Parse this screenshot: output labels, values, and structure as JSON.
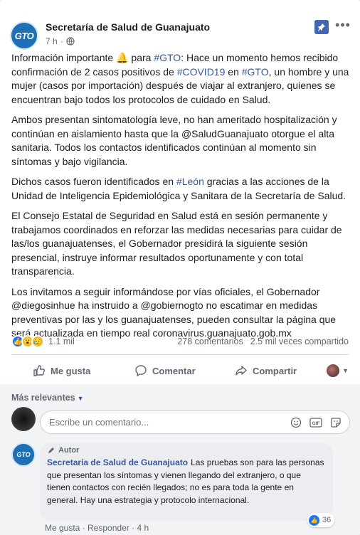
{
  "post": {
    "page_name": "Secretaría de Salud de Guanajuato",
    "avatar_text": "GTO",
    "time": "7 h",
    "paragraphs": {
      "p1": {
        "a": "Información importante ",
        "emoji": "🔔",
        "b": " para ",
        "tag1": "#GTO",
        "c": ": Hace un momento hemos recibido confirmación de 2 casos positivos de ",
        "tag2": "#COVID19",
        "d": " en ",
        "tag3": "#GTO",
        "e": ", un hombre y una mujer (casos por importación) después de viajar al extranjero, quienes se encuentran bajo todos los protocolos de cuidado en Salud."
      },
      "p2": "Ambos presentan sintomatología leve, no han ameritado hospitalización y continúan en aislamiento hasta que la @SaludGuanajuato otorgue el alta sanitaria. Todos los contactos identificados continúan al momento sin síntomas y bajo vigilancia.",
      "p3": {
        "a": "Dichos casos fueron identificados en ",
        "tag": "#León",
        "b": " gracias a las acciones de la Unidad de Inteligencia Epidemiológica y Sanitara de la Secretaría de Salud."
      },
      "p4": "El Consejo Estatal de Seguridad en Salud está en sesión permanente y trabajamos coordinados en reforzar las medidas necesarias para cuidar de las/los guanajuatenses, el Gobernador presidirá la siguiente sesión presencial, instruye informar resultados oportunamente y con total transparencia.",
      "p5": "Los invitamos a seguir informándose por vías oficiales, el Gobernador @diegosinhue ha instruido a @gobiernogto no escatimar en medidas preventivas por las y los guanajuatenses, pueden consultar la página que será actualizada en tiempo real coronavirus.guanajuato.gob.mx"
    }
  },
  "reactions": {
    "count": "1.1 mil",
    "comments": "278 comentarios",
    "shares": "2.5 mil veces compartido"
  },
  "actions": {
    "like": "Me gusta",
    "comment": "Comentar",
    "share": "Compartir"
  },
  "comments": {
    "sort_label": "Más relevantes",
    "input_placeholder": "Escribe un comentario...",
    "gif_label": "GIF",
    "top_comment": {
      "badge": "Autor",
      "author": "Secretaría de Salud de Guanajuato",
      "avatar_text": "GTO",
      "text": "Las pruebas son para las personas que presentan los síntomas y vienen llegando del extranjero, o que tienen contactos con recién llegados; no es para toda la gente en general. Hay una estrategia y protocolo internacional.",
      "likes": "36",
      "like_label": "Me gusta",
      "reply_label": "Responder",
      "time": "4 h"
    }
  },
  "colors": {
    "brand_blue": "#385898",
    "like_blue": "#1877f2",
    "avatar_blue": "#1d6fb6"
  }
}
